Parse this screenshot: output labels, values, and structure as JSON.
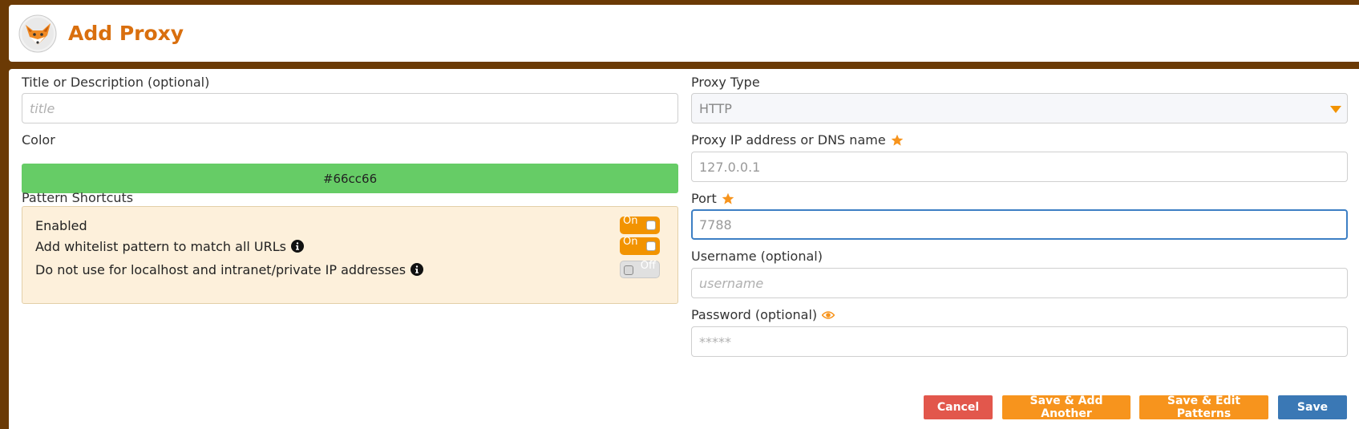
{
  "header": {
    "title": "Add Proxy"
  },
  "form": {
    "title_label": "Title or Description (optional)",
    "title_placeholder": "title",
    "color_label": "Color",
    "color_value": "#66cc66",
    "shortcuts_label": "Pattern Shortcuts",
    "shortcuts": [
      {
        "label": "Enabled",
        "state": "On",
        "info": false
      },
      {
        "label": "Add whitelist pattern to match all URLs",
        "state": "On",
        "info": true
      },
      {
        "label": "Do not use for localhost and intranet/private IP addresses",
        "state": "Off",
        "info": true
      }
    ],
    "proxy_type_label": "Proxy Type",
    "proxy_type_value": "HTTP",
    "proxy_ip_label": "Proxy IP address or DNS name",
    "proxy_ip_value": "127.0.0.1",
    "port_label": "Port",
    "port_value": "7788",
    "username_label": "Username (optional)",
    "username_placeholder": "username",
    "password_label": "Password (optional)",
    "password_placeholder": "*****"
  },
  "buttons": {
    "cancel": "Cancel",
    "save_add_another": "Save & Add Another",
    "save_edit_patterns": "Save & Edit Patterns",
    "save": "Save"
  },
  "colors": {
    "background": "#6b3a05",
    "accent_orange": "#f7941d",
    "title_orange": "#d96f0e",
    "cancel_red": "#e2574c",
    "save_blue": "#3a78b5",
    "proxy_color": "#66cc66",
    "shortcuts_bg": "#fdf0db"
  },
  "icons": {
    "logo": "foxyproxy-fox-logo",
    "required": "star-icon",
    "info": "info-icon",
    "show_password": "eye-icon"
  }
}
